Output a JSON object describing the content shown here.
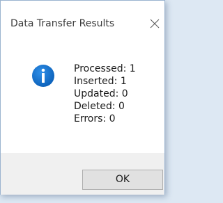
{
  "dialog": {
    "title": "Data Transfer Results",
    "icon": "info-icon",
    "accent_color": "#0a6fcf",
    "messages": {
      "processed": "Processed: 1",
      "inserted": "Inserted: 1",
      "updated": "Updated: 0",
      "deleted": "Deleted: 0",
      "errors": "Errors: 0"
    },
    "ok_label": "OK",
    "close_icon": "close-icon"
  }
}
